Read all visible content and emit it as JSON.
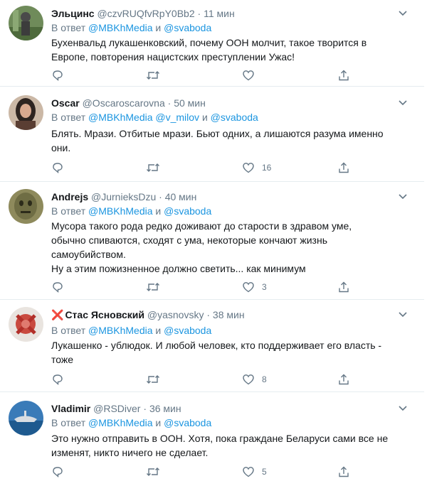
{
  "tweets": [
    {
      "name": "Эльцинс",
      "handle": "@czvRUQfvRpY0Bb2",
      "time": "11 мин",
      "reply_prefix": "В ответ",
      "mention1": "@MBKhMedia",
      "conj": "и",
      "mention2": "@svaboda",
      "text": [
        "Бухенвальд лукашенковский, почему ООН молчит, такое творится в",
        "Европе, повторения нацистских преступлении Ужас!"
      ],
      "likes": ""
    },
    {
      "name": "Oscar",
      "handle": "@Oscaroscarovna",
      "time": "50 мин",
      "reply_prefix": "В ответ",
      "mention1": "@MBKhMedia",
      "conj": "и",
      "mention_mid": "@v_milov",
      "mention2": "@svaboda",
      "text": [
        "Блять. Мрази. Отбитые мрази. Бьют одних, а лишаются разума именно",
        "они."
      ],
      "likes": "16"
    },
    {
      "name": "Andrejs",
      "handle": "@JurnieksDzu",
      "time": "40 мин",
      "reply_prefix": "В ответ",
      "mention1": "@MBKhMedia",
      "conj": "и",
      "mention2": "@svaboda",
      "text": [
        "Мусора такого рода редко доживают до старости в здравом уме,",
        "обычно спиваются, сходят с ума, некоторые кончают жизнь",
        "самоубийством.",
        "Ну а этим пожизненное должно светить... как минимум"
      ],
      "likes": "3"
    },
    {
      "name_prefix": "❌",
      "name": "Стас Ясновский",
      "handle": "@yasnovsky",
      "time": "38 мин",
      "reply_prefix": "В ответ",
      "mention1": "@MBKhMedia",
      "conj": "и",
      "mention2": "@svaboda",
      "text": [
        "Лукашенко - ублюдок. И любой человек, кто поддерживает его власть -",
        "тоже"
      ],
      "likes": "8"
    },
    {
      "name": "Vladimir",
      "handle": "@RSDiver",
      "time": "36 мин",
      "reply_prefix": "В ответ",
      "mention1": "@MBKhMedia",
      "conj": "и",
      "mention2": "@svaboda",
      "text": [
        "Это нужно отправить в ООН. Хотя, пока граждане Беларуси сами все не",
        "изменят, никто ничего не сделает."
      ],
      "likes": "5"
    }
  ],
  "separator": "·",
  "colors": {
    "link": "#1b95e0",
    "muted": "#657786",
    "text": "#14171a",
    "border": "#e6ecf0"
  },
  "icons": [
    "chevron-down-icon",
    "reply-icon",
    "retweet-icon",
    "like-icon",
    "share-icon"
  ]
}
